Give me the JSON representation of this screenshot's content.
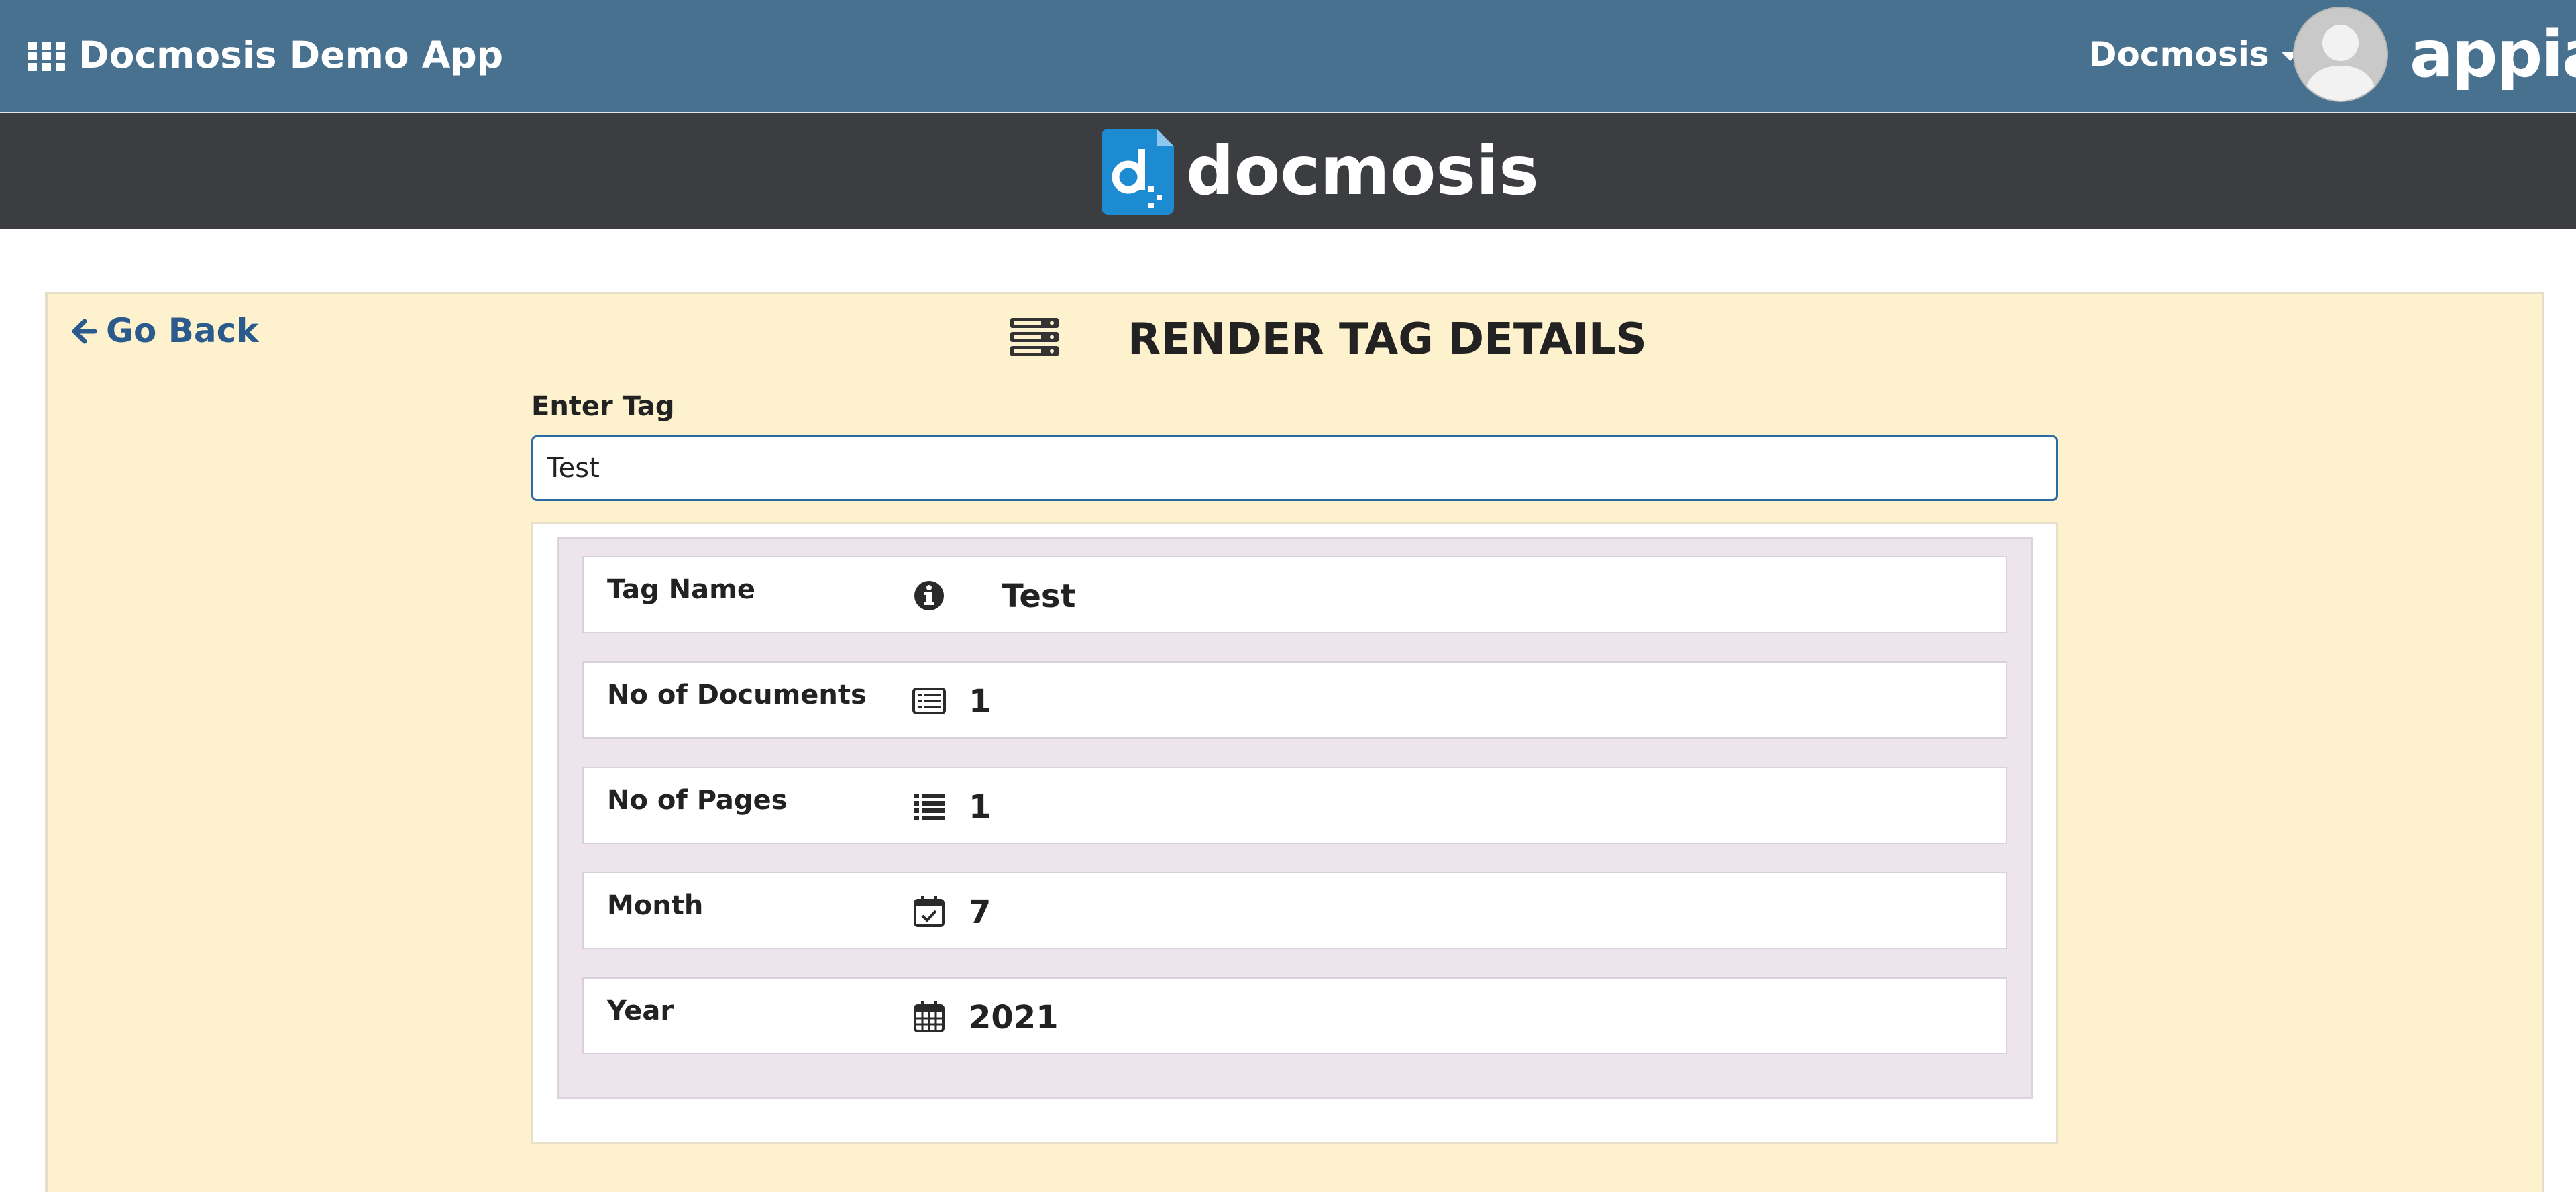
{
  "topbar": {
    "title": "Docmosis Demo App",
    "user_menu_label": "Docmosis",
    "platform_logo": "appian"
  },
  "brand": {
    "name": "docmosis"
  },
  "page": {
    "back_label": "Go Back",
    "title": "RENDER TAG DETAILS",
    "tag_field_label": "Enter Tag",
    "tag_value": "Test"
  },
  "details": {
    "rows": [
      {
        "label": "Tag Name",
        "icon": "info-circle-icon",
        "value": "Test"
      },
      {
        "label": "No of Documents",
        "icon": "list-alt-icon",
        "value": "1"
      },
      {
        "label": "No of Pages",
        "icon": "list-icon",
        "value": "1"
      },
      {
        "label": "Month",
        "icon": "calendar-check-icon",
        "value": "7"
      },
      {
        "label": "Year",
        "icon": "calendar-icon",
        "value": "2021"
      }
    ]
  },
  "colors": {
    "topbar": "#48708f",
    "brandbar": "#3c3d40",
    "card": "#fdf2cd",
    "link": "#2b5b8c",
    "brand_blue": "#1d8bd1"
  }
}
